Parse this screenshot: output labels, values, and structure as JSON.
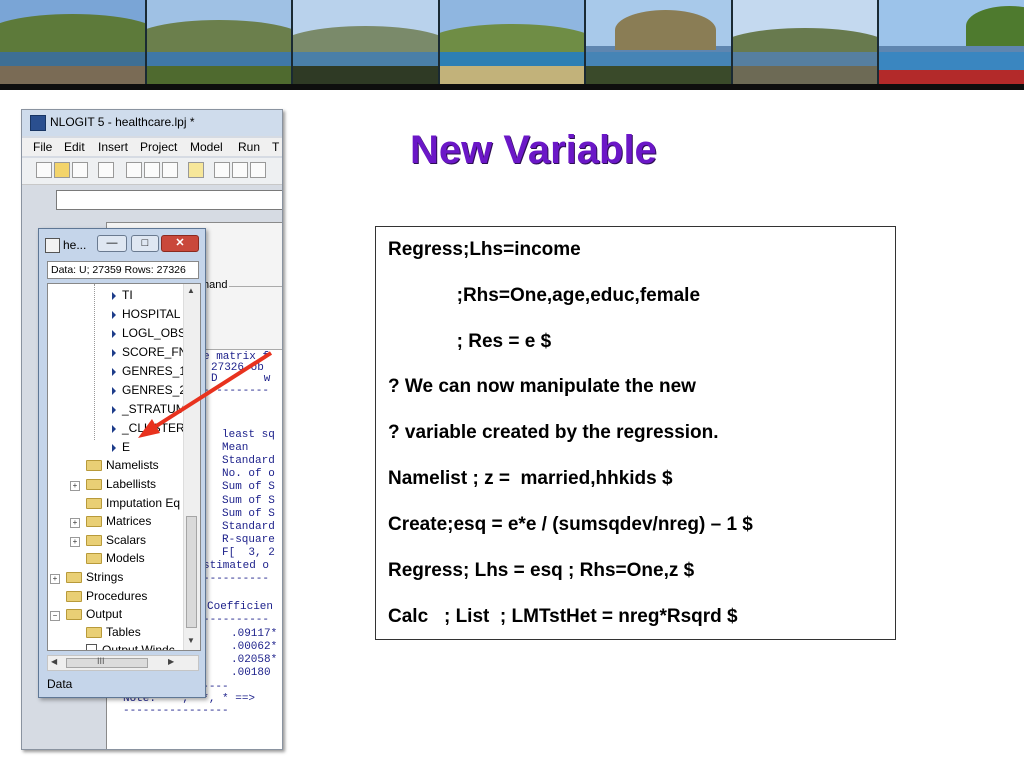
{
  "slide": {
    "title": "New Variable",
    "code_lines": [
      "Regress;Lhs=income",
      "             ;Rhs=One,age,educ,female",
      "             ; Res = e $",
      "? We can now manipulate the new",
      "? variable created by the regression.",
      "Namelist ; z =  married,hhkids $",
      "Create;esq = e*e / (sumsqdev/nreg) – 1 $",
      "Regress; Lhs = esq ; Rhs=One,z $",
      "Calc   ; List  ; LMTstHet = nreg*Rsqrd $"
    ]
  },
  "nlogit": {
    "title": "NLOGIT 5 - healthcare.lpj *",
    "menu": [
      "File",
      "Edit",
      "Insert",
      "Project",
      "Model",
      "Run",
      "T"
    ],
    "output_fragments": [
      "e matrix f",
      "27326 ob",
      "D       w",
      "least sq",
      "Mean",
      "Standard",
      "No. of o",
      "Sum of S",
      "Sum of S",
      "Sum of S",
      "Standard",
      "R-square",
      "F[  3, 2",
      "stimated o",
      "Coefficien",
      ".09117*",
      ".00062*",
      ".02058*",
      ".00180",
      "Note: ***, **, * ==>"
    ],
    "hand_label": "hand"
  },
  "project_window": {
    "title": "he...",
    "status": "Data: U; 27359 Rows: 27326",
    "variables": [
      "TI",
      "HOSPITAL",
      "LOGL_OBS",
      "SCORE_FN",
      "GENRES_1",
      "GENRES_2",
      "_STRATUM",
      "_CLUSTER",
      "E"
    ],
    "folders": [
      "Namelists",
      "Labellists",
      "Imputation Eq",
      "Matrices",
      "Scalars",
      "Models",
      "Strings",
      "Procedures",
      "Output",
      "Tables"
    ],
    "output_window_item": "Output Windc",
    "footer": "Data",
    "hscroll_glyph": "III"
  },
  "colors": {
    "title_purple": "#6b17c7",
    "close_red": "#c9483b"
  }
}
